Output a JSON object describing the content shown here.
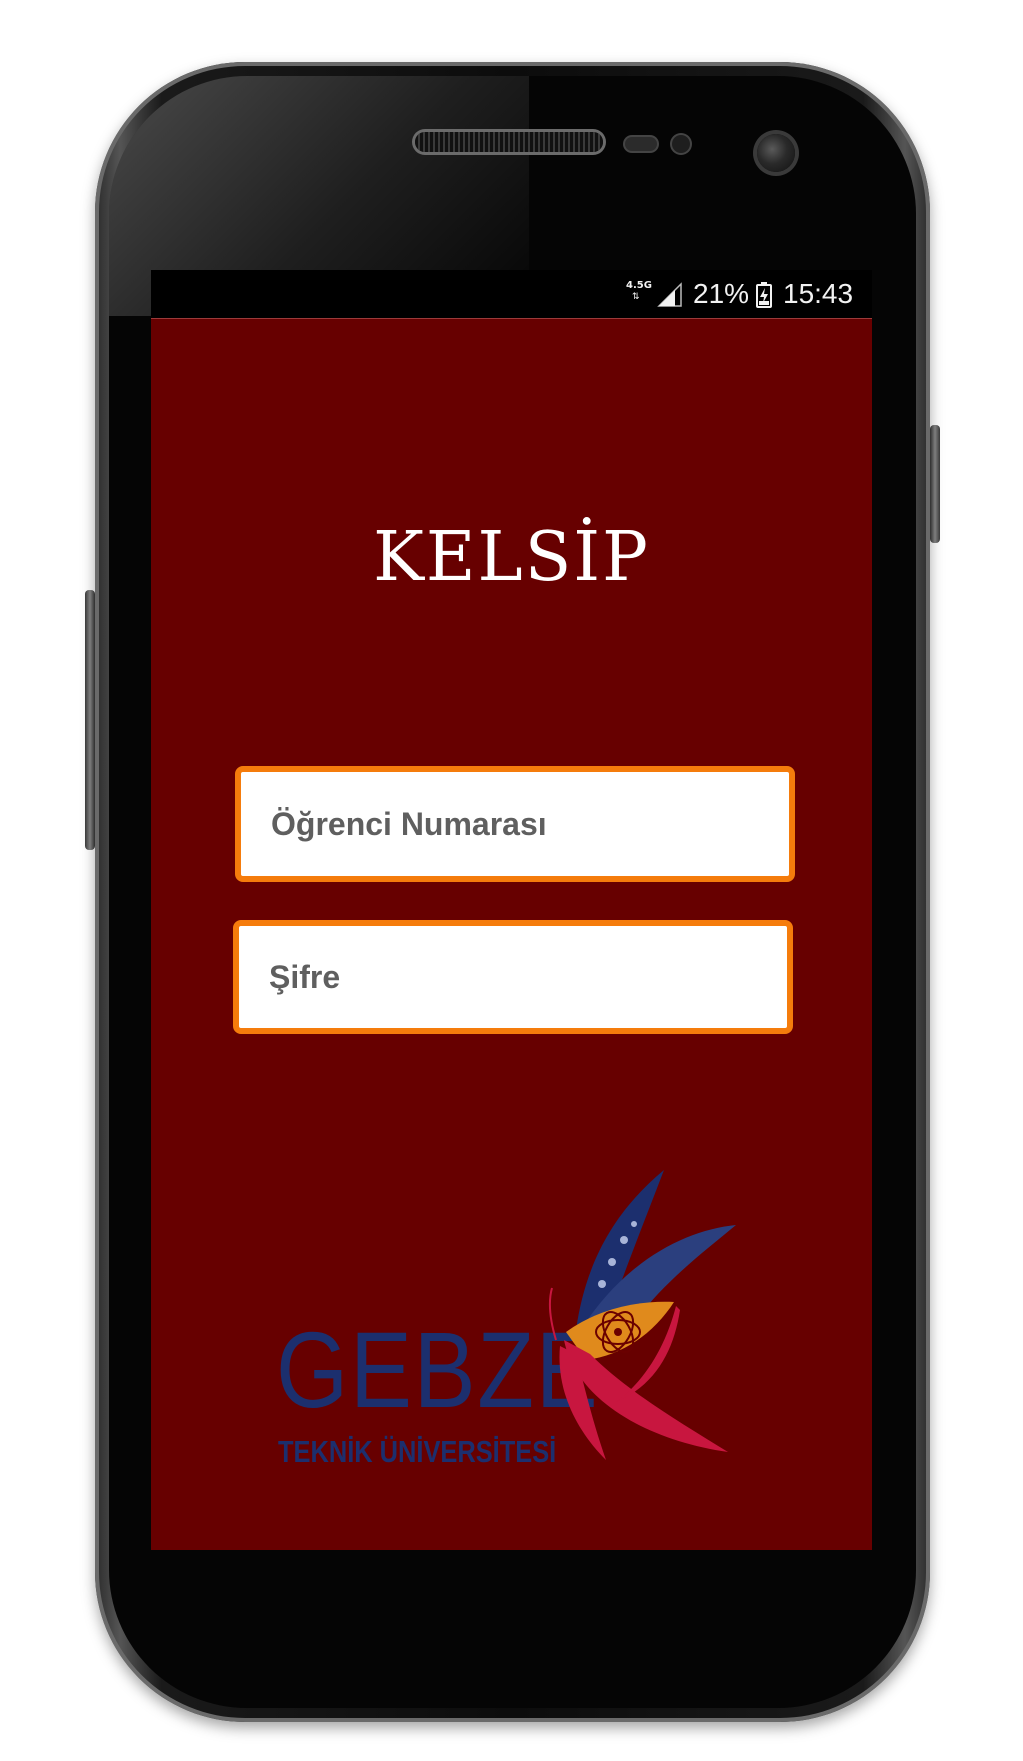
{
  "status_bar": {
    "network": "4.5G",
    "battery_percent": "21%",
    "time": "15:43",
    "icons": [
      "data-arrows-icon",
      "signal-icon",
      "battery-charging-icon"
    ]
  },
  "app": {
    "title": "KELSİP",
    "background_color": "#670000",
    "accent_color": "#f57c0c"
  },
  "form": {
    "student_number_placeholder": "Öğrenci Numarası",
    "password_placeholder": "Şifre"
  },
  "logo": {
    "name": "GEBZE",
    "subtitle": "TEKNİK ÜNİVERSİTESİ",
    "colors": [
      "#1c2f6e",
      "#e08a1c",
      "#c8163f"
    ]
  }
}
